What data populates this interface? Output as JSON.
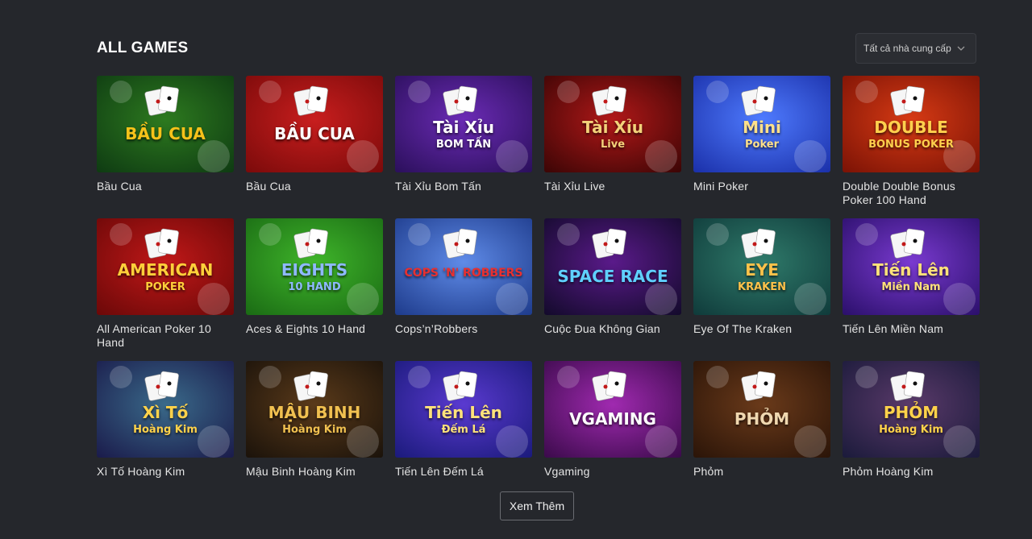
{
  "section": {
    "title": "ALL GAMES",
    "provider_select": {
      "value": "Tất cả nhà cung cấp"
    }
  },
  "games": [
    {
      "name": "Bầu Cua",
      "logo": "BẦU CUA",
      "sub": "",
      "bg": [
        "#0e3a12",
        "#2d7a1f"
      ],
      "text": "#f6c21a"
    },
    {
      "name": "Bầu Cua",
      "logo": "BẦU CUA",
      "sub": "",
      "bg": [
        "#7a0a0a",
        "#c81e1e"
      ],
      "text": "#ffffff"
    },
    {
      "name": "Tài Xỉu Bom Tấn",
      "logo": "Tài Xỉu",
      "sub": "BOM TẤN",
      "bg": [
        "#2a0f5a",
        "#6b2bb5"
      ],
      "text": "#ffffff"
    },
    {
      "name": "Tài Xỉu Live",
      "logo": "Tài Xỉu",
      "sub": "Live",
      "bg": [
        "#3a0505",
        "#b01818"
      ],
      "text": "#f3d27a"
    },
    {
      "name": "Mini Poker",
      "logo": "Mini",
      "sub": "Poker",
      "bg": [
        "#1a2fa8",
        "#4f7bff"
      ],
      "text": "#ffe08a"
    },
    {
      "name": "Double Double Bonus Poker 100 Hand",
      "logo": "DOUBLE",
      "sub": "BONUS POKER",
      "bg": [
        "#7a1205",
        "#d63a14"
      ],
      "text": "#ffd04d"
    },
    {
      "name": "All American Poker 10 Hand",
      "logo": "AMERICAN",
      "sub": "POKER",
      "bg": [
        "#6a0808",
        "#c01818"
      ],
      "text": "#ffcf3a"
    },
    {
      "name": "Aces & Eights 10 Hand",
      "logo": "EIGHTS",
      "sub": "10 HAND",
      "bg": [
        "#1a6a14",
        "#3fb52a"
      ],
      "text": "#8fb8ff"
    },
    {
      "name": "Cops’n’Robbers",
      "logo": "COPS 'N' ROBBERS",
      "sub": "",
      "bg": [
        "#1d3a8a",
        "#5f8be8"
      ],
      "text": "#e83030"
    },
    {
      "name": "Cuộc Đua Không Gian",
      "logo": "SPACE RACE",
      "sub": "",
      "bg": [
        "#120a2a",
        "#5a1a8a"
      ],
      "text": "#5fd0ff"
    },
    {
      "name": "Eye Of The Kraken",
      "logo": "EYE",
      "sub": "KRAKEN",
      "bg": [
        "#0f3a3a",
        "#2f7a6a"
      ],
      "text": "#ffc24a"
    },
    {
      "name": "Tiến Lên Miền Nam",
      "logo": "Tiến Lên",
      "sub": "Miền Nam",
      "bg": [
        "#2a0f6a",
        "#7a3ad0"
      ],
      "text": "#ffe27a"
    },
    {
      "name": "Xì Tố Hoàng Kim",
      "logo": "Xì Tố",
      "sub": "Hoàng Kim",
      "bg": [
        "#1a1a4a",
        "#3a6a8a"
      ],
      "text": "#ffd24a"
    },
    {
      "name": "Mậu Binh Hoàng Kim",
      "logo": "MẬU BINH",
      "sub": "Hoàng Kim",
      "bg": [
        "#1a120a",
        "#5a3a1a"
      ],
      "text": "#f0c050"
    },
    {
      "name": "Tiến Lên Đếm Lá",
      "logo": "Tiến Lên",
      "sub": "Đếm Lá",
      "bg": [
        "#1a1a7a",
        "#5a3ad0"
      ],
      "text": "#ffe27a"
    },
    {
      "name": "Vgaming",
      "logo": "VGAMING",
      "sub": "",
      "bg": [
        "#3a0a4a",
        "#a02ab0"
      ],
      "text": "#ffffff"
    },
    {
      "name": "Phỏm",
      "logo": "PHỎM",
      "sub": "",
      "bg": [
        "#2a1408",
        "#6a3a1a"
      ],
      "text": "#f0d8b0"
    },
    {
      "name": "Phỏm Hoàng Kim",
      "logo": "PHỎM",
      "sub": "Hoàng Kim",
      "bg": [
        "#1a1a3a",
        "#5a3a6a"
      ],
      "text": "#ffd24a"
    }
  ],
  "more_button": {
    "label": "Xem Thêm"
  }
}
